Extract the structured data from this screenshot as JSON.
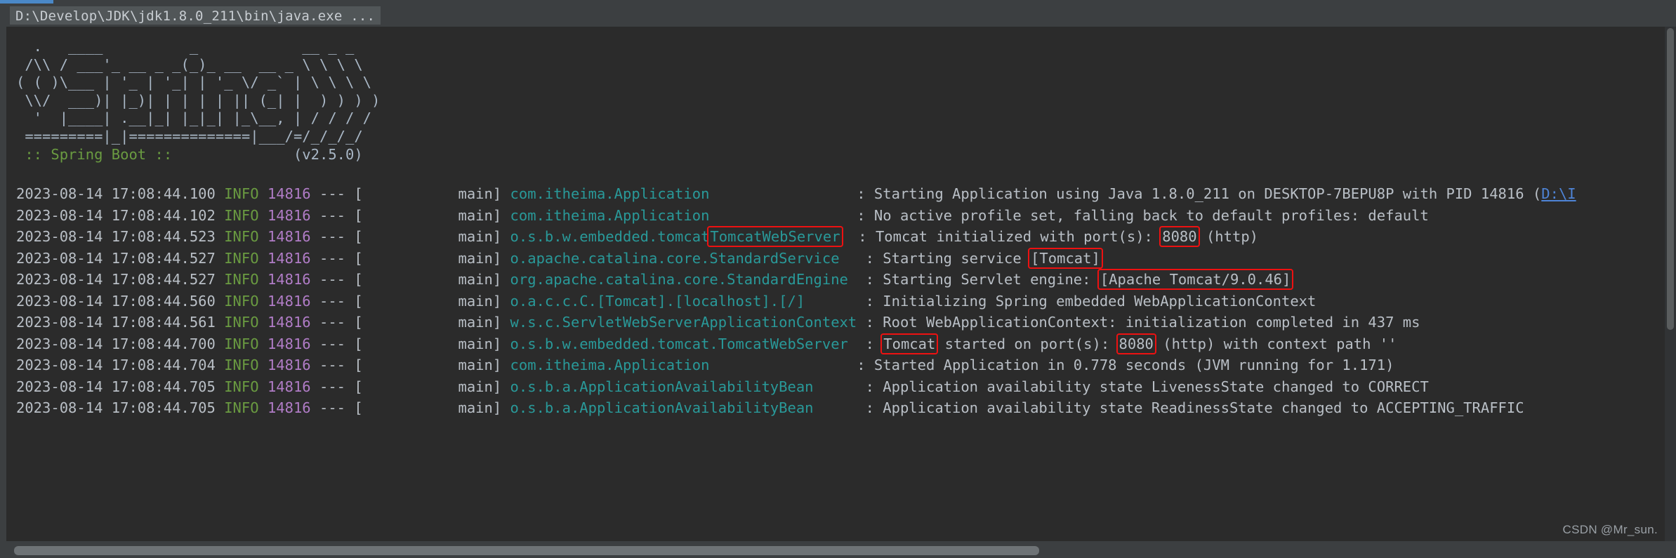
{
  "window": {
    "accent_color": "#4a88c7",
    "titlebar_background": "#3c3f41",
    "title": "D:\\Develop\\JDK\\jdk1.8.0_211\\bin\\java.exe ..."
  },
  "console": {
    "background": "#2b2b2b",
    "banner": {
      "lines": [
        "  .   ____          _            __ _ _",
        " /\\\\ / ___'_ __ _ _(_)_ __  __ _ \\ \\ \\ \\",
        "( ( )\\___ | '_ | '_| | '_ \\/ _` | \\ \\ \\ \\",
        " \\\\/  ___)| |_)| | | | | || (_| |  ) ) ) )",
        "  '  |____| .__|_| |_|_| |_\\__, | / / / /",
        " =========|_|==============|___/=/_/_/_/"
      ],
      "footer_label": " :: Spring Boot :: ",
      "footer_version": "             (v2.5.0)",
      "footer_color": "#6a9b41"
    },
    "log_colors": {
      "timestamp": "#b9bfc6",
      "level": "#6a9b41",
      "pid": "#b07cc6",
      "logger": "#299999",
      "message": "#b9bfc6",
      "link": "#4e84d6",
      "highlight_box": "#ee1111"
    },
    "lines": [
      {
        "timestamp": "2023-08-14 17:08:44.100",
        "level": "INFO",
        "pid": "14816",
        "sep": "--- [",
        "thread": "           main]",
        "logger": "com.itheima.Application                 ",
        "colon": ": ",
        "msg_pre": "Starting Application using Java 1.8.0_211 on DESKTOP-7BEPU8P with PID 14816 (",
        "msg_link": "D:\\I",
        "msg_post": ""
      },
      {
        "timestamp": "2023-08-14 17:08:44.102",
        "level": "INFO",
        "pid": "14816",
        "sep": "--- [",
        "thread": "           main]",
        "logger": "com.itheima.Application                 ",
        "colon": ": ",
        "msg_pre": "No active profile set, falling back to default profiles: default",
        "msg_link": "",
        "msg_post": ""
      },
      {
        "timestamp": "2023-08-14 17:08:44.523",
        "level": "INFO",
        "pid": "14816",
        "sep": "--- [",
        "thread": "           main]",
        "logger_pre": "o.s.b.w.embedded.tomcat",
        "logger_hl": "TomcatWebServer",
        "logger_post": "  ",
        "colon": ": ",
        "msg_pre": "Tomcat initialized with port(s): ",
        "msg_hl": "8080",
        "msg_post": " (http)"
      },
      {
        "timestamp": "2023-08-14 17:08:44.527",
        "level": "INFO",
        "pid": "14816",
        "sep": "--- [",
        "thread": "           main]",
        "logger": "o.apache.catalina.core.StandardService   ",
        "colon": ": ",
        "msg_pre": "Starting service ",
        "msg_hl": "[Tomcat]",
        "msg_post": ""
      },
      {
        "timestamp": "2023-08-14 17:08:44.527",
        "level": "INFO",
        "pid": "14816",
        "sep": "--- [",
        "thread": "           main]",
        "logger": "org.apache.catalina.core.StandardEngine  ",
        "colon": ": ",
        "msg_pre": "Starting Servlet engine: ",
        "msg_hl": "[Apache Tomcat/9.0.46]",
        "msg_post": ""
      },
      {
        "timestamp": "2023-08-14 17:08:44.560",
        "level": "INFO",
        "pid": "14816",
        "sep": "--- [",
        "thread": "           main]",
        "logger": "o.a.c.c.C.[Tomcat].[localhost].[/]       ",
        "colon": ": ",
        "msg_pre": "Initializing Spring embedded WebApplicationContext",
        "msg_hl": "",
        "msg_post": ""
      },
      {
        "timestamp": "2023-08-14 17:08:44.561",
        "level": "INFO",
        "pid": "14816",
        "sep": "--- [",
        "thread": "           main]",
        "logger": "w.s.c.ServletWebServerApplicationContext",
        "colon": " : ",
        "msg_pre": "Root WebApplicationContext: initialization completed in 437 ms",
        "msg_hl": "",
        "msg_post": ""
      },
      {
        "timestamp": "2023-08-14 17:08:44.700",
        "level": "INFO",
        "pid": "14816",
        "sep": "--- [",
        "thread": "           main]",
        "logger": "o.s.b.w.embedded.tomcat.TomcatWebServer ",
        "colon": " : ",
        "msg_pre": "",
        "msg_hl": "Tomcat",
        "msg_mid": " started on port(s): ",
        "msg_hl2": "8080",
        "msg_post": " (http) with context path ''"
      },
      {
        "timestamp": "2023-08-14 17:08:44.704",
        "level": "INFO",
        "pid": "14816",
        "sep": "--- [",
        "thread": "           main]",
        "logger": "com.itheima.Application                 ",
        "colon": ": ",
        "msg_pre": "Started Application in 0.778 seconds (JVM running for 1.171)",
        "msg_hl": "",
        "msg_post": ""
      },
      {
        "timestamp": "2023-08-14 17:08:44.705",
        "level": "INFO",
        "pid": "14816",
        "sep": "--- [",
        "thread": "           main]",
        "logger": "o.s.b.a.ApplicationAvailabilityBean      ",
        "colon": ": ",
        "msg_pre": "Application availability state LivenessState changed to CORRECT",
        "msg_hl": "",
        "msg_post": ""
      },
      {
        "timestamp": "2023-08-14 17:08:44.705",
        "level": "INFO",
        "pid": "14816",
        "sep": "--- [",
        "thread": "           main]",
        "logger": "o.s.b.a.ApplicationAvailabilityBean      ",
        "colon": ": ",
        "msg_pre": "Application availability state ReadinessState changed to ACCEPTING_TRAFFIC",
        "msg_hl": "",
        "msg_post": ""
      }
    ]
  },
  "watermark": "CSDN @Mr_sun."
}
